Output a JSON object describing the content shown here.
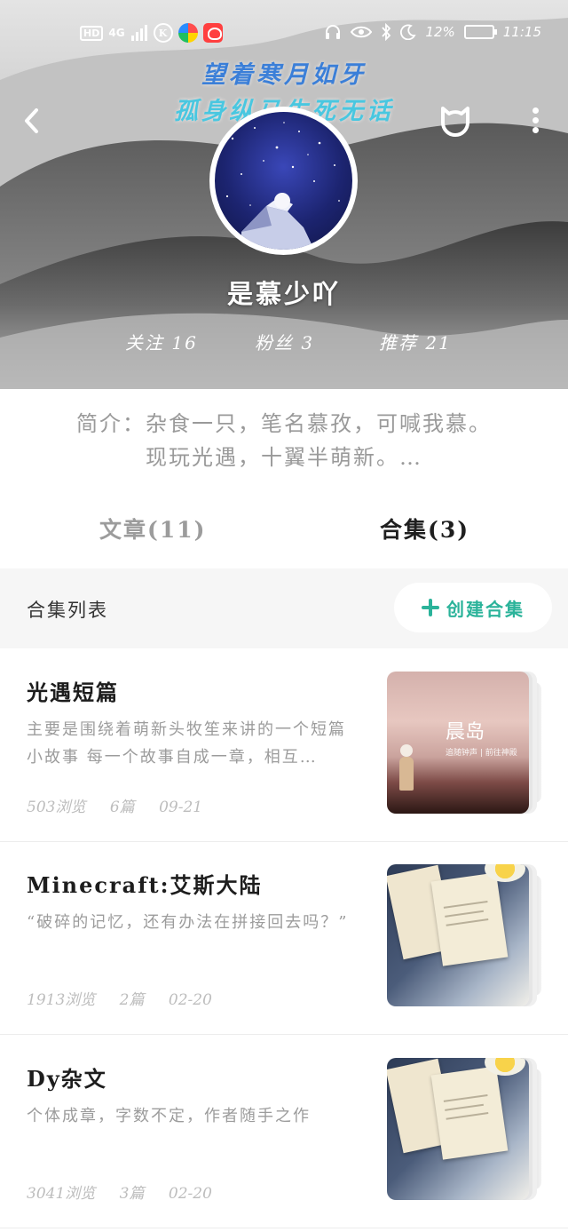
{
  "status_bar": {
    "left_badges": [
      "HD",
      "4G"
    ],
    "battery": "12%",
    "time": "11:15"
  },
  "header": {
    "slogan_line1": "望着寒月如牙",
    "slogan_line2": "孤身纵马生死无话",
    "username": "是慕少吖",
    "stats": {
      "follow": "关注 16",
      "fans": "粉丝 3",
      "recommend": "推荐 21"
    }
  },
  "bio": {
    "line1": "简介：杂食一只，笔名慕孜，可喊我慕。",
    "line2": "现玩光遇，十翼半萌新。…"
  },
  "tabs": {
    "articles": "文章(11)",
    "collections": "合集(3)",
    "active": "collections"
  },
  "list_header": {
    "title": "合集列表",
    "create_label": "创建合集"
  },
  "collections": [
    {
      "title": "光遇短篇",
      "desc": "主要是围绕着萌新头牧笙来讲的一个短篇小故事 每一个故事自成一章，相互…",
      "views": "503浏览",
      "count": "6篇",
      "date": "09-21",
      "thumb_title": "晨岛",
      "thumb_sub": "追随钟声 | 前往神殿"
    },
    {
      "title": "Minecraft:艾斯大陆",
      "desc": "“破碎的记忆，还有办法在拼接回去吗？”",
      "views": "1913浏览",
      "count": "2篇",
      "date": "02-20"
    },
    {
      "title": "Dy杂文",
      "desc": "个体成章，字数不定，作者随手之作",
      "views": "3041浏览",
      "count": "3篇",
      "date": "02-20"
    }
  ],
  "colors": {
    "accent": "#2bb39a",
    "slogan1": "#3b7fd8",
    "slogan2": "#49c7e0"
  }
}
